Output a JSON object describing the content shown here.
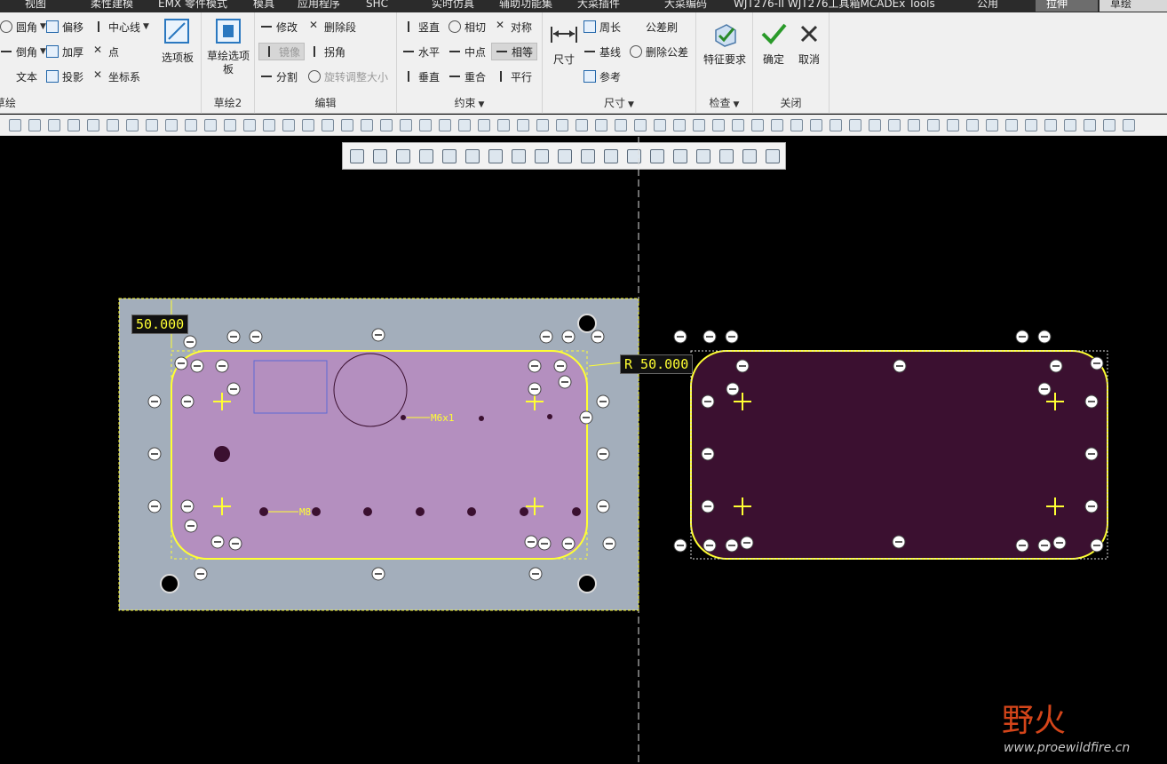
{
  "tabs": [
    "视图",
    "柔性建模",
    "EMX 零件模式",
    "模具",
    "应用程序",
    "SHC",
    "实时仿真",
    "辅助功能集",
    "大菜插件",
    "大菜编码",
    "WJT276-II WJT276工具箱MCADEx Tools",
    "公用",
    "拉伸",
    "草绘"
  ],
  "ribbon": {
    "sketch_group": {
      "items": [
        "圆角",
        "倒角",
        "文本",
        "偏移",
        "加厚",
        "投影",
        "中心线",
        "点",
        "坐标系"
      ],
      "big": "选项板",
      "label": "草绘"
    },
    "sketch2_group": {
      "big": "草绘选项板",
      "label": "草绘2"
    },
    "edit_group": {
      "items": [
        "修改",
        "删除段",
        "镜像",
        "拐角",
        "分割",
        "旋转调整大小"
      ],
      "label": "编辑"
    },
    "constraint_group": {
      "items": [
        "竖直",
        "相切",
        "对称",
        "水平",
        "中点",
        "相等",
        "垂直",
        "重合",
        "平行"
      ],
      "label": "约束"
    },
    "dimension_group": {
      "big": "尺寸",
      "items": [
        "周长",
        "公差刷",
        "基线",
        "删除公差",
        "参考"
      ],
      "label": "尺寸"
    },
    "inspect_group": {
      "big": "特征要求",
      "label": "检查"
    },
    "close_group": {
      "ok": "确定",
      "cancel": "取消",
      "label": "关闭"
    }
  },
  "drawing": {
    "dim_top": "50.000",
    "dim_radius": "R 50.000",
    "label_m6": "M6x1",
    "label_m8": "M8"
  },
  "watermark": {
    "logo": "野火",
    "url": "www.proewildfire.cn"
  },
  "colors": {
    "ribbon_bg": "#f0f0f0",
    "canvas_bg": "#000000",
    "plate_gray": "#a3aebb",
    "pocket_pink": "#b48fbf",
    "pocket_dark": "#3b1030",
    "sketch_yellow": "#ffff33"
  }
}
